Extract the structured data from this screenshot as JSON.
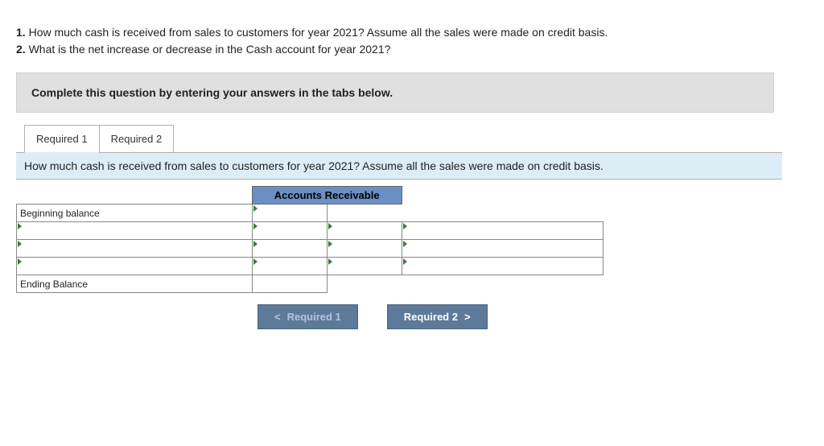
{
  "questions": {
    "q1_num": "1.",
    "q1_text": "How much cash is received from sales to customers for year 2021? Assume all the sales were made on credit basis.",
    "q2_num": "2.",
    "q2_text": "What is the net increase or decrease in the Cash account for year 2021?"
  },
  "instruction": "Complete this question by entering your answers in the tabs below.",
  "tabs": {
    "tab1": "Required 1",
    "tab2": "Required 2"
  },
  "prompt": "How much cash is received from sales to customers for year 2021? Assume all the sales were made on credit basis.",
  "taccount": {
    "title": "Accounts Receivable",
    "beginning": "Beginning balance",
    "ending": "Ending Balance"
  },
  "nav": {
    "prev": "Required 1",
    "next": "Required 2"
  }
}
